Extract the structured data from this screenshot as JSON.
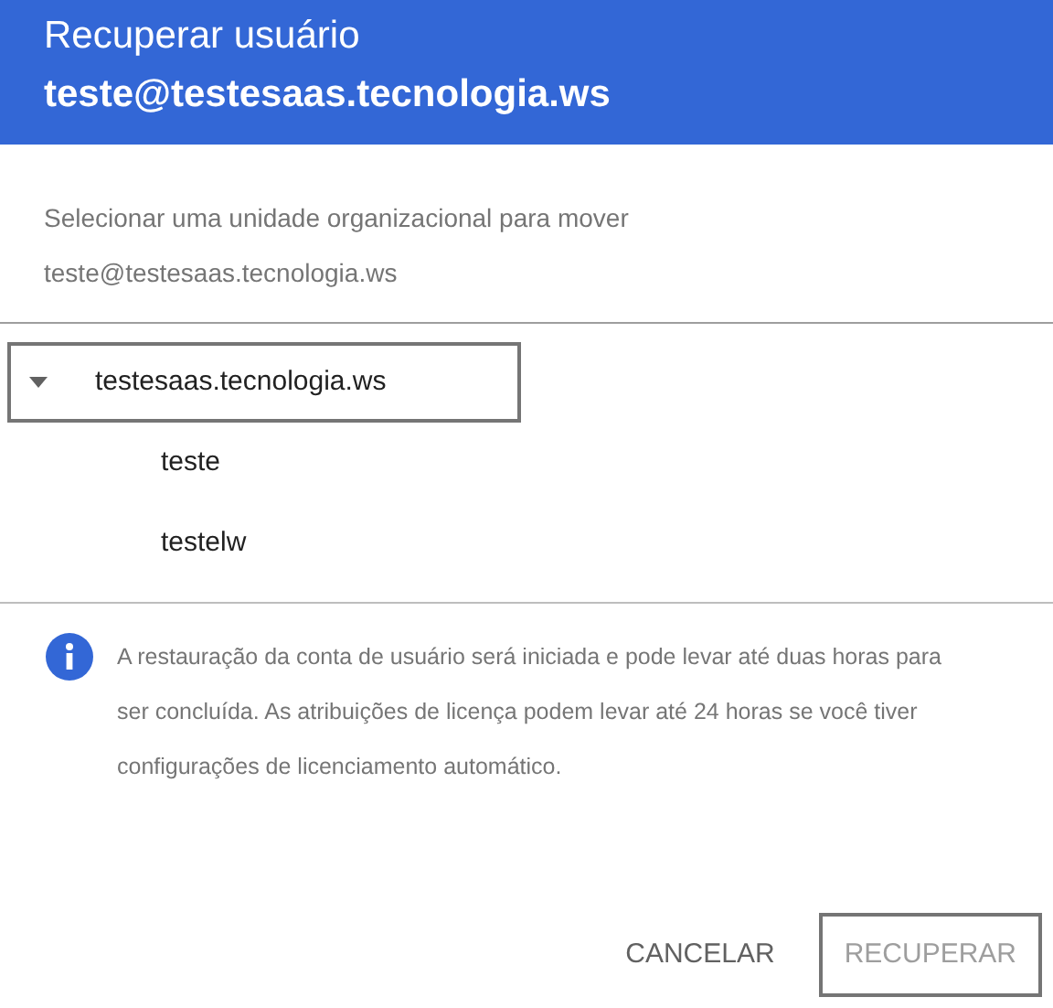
{
  "header": {
    "title": "Recuperar usuário",
    "subtitle": "teste@testesaas.tecnologia.ws"
  },
  "description": "Selecionar uma unidade organizacional para mover teste@testesaas.tecnologia.ws",
  "tree": [
    {
      "label": "testesaas.tecnologia.ws",
      "expanded": true,
      "focused": true,
      "children": [
        {
          "label": "teste",
          "focused": false
        },
        {
          "label": "testelw",
          "focused": false
        }
      ]
    }
  ],
  "notice": {
    "text": "A restauração da conta de usuário será iniciada e pode levar até duas horas para ser concluída. As atribuições de licença podem levar até 24 horas se você tiver configurações de licenciamento automático."
  },
  "buttons": [
    {
      "label": "CANCELAR",
      "disabled": false,
      "focused": false
    },
    {
      "label": "RECUPERAR",
      "disabled": true,
      "focused": true
    }
  ]
}
